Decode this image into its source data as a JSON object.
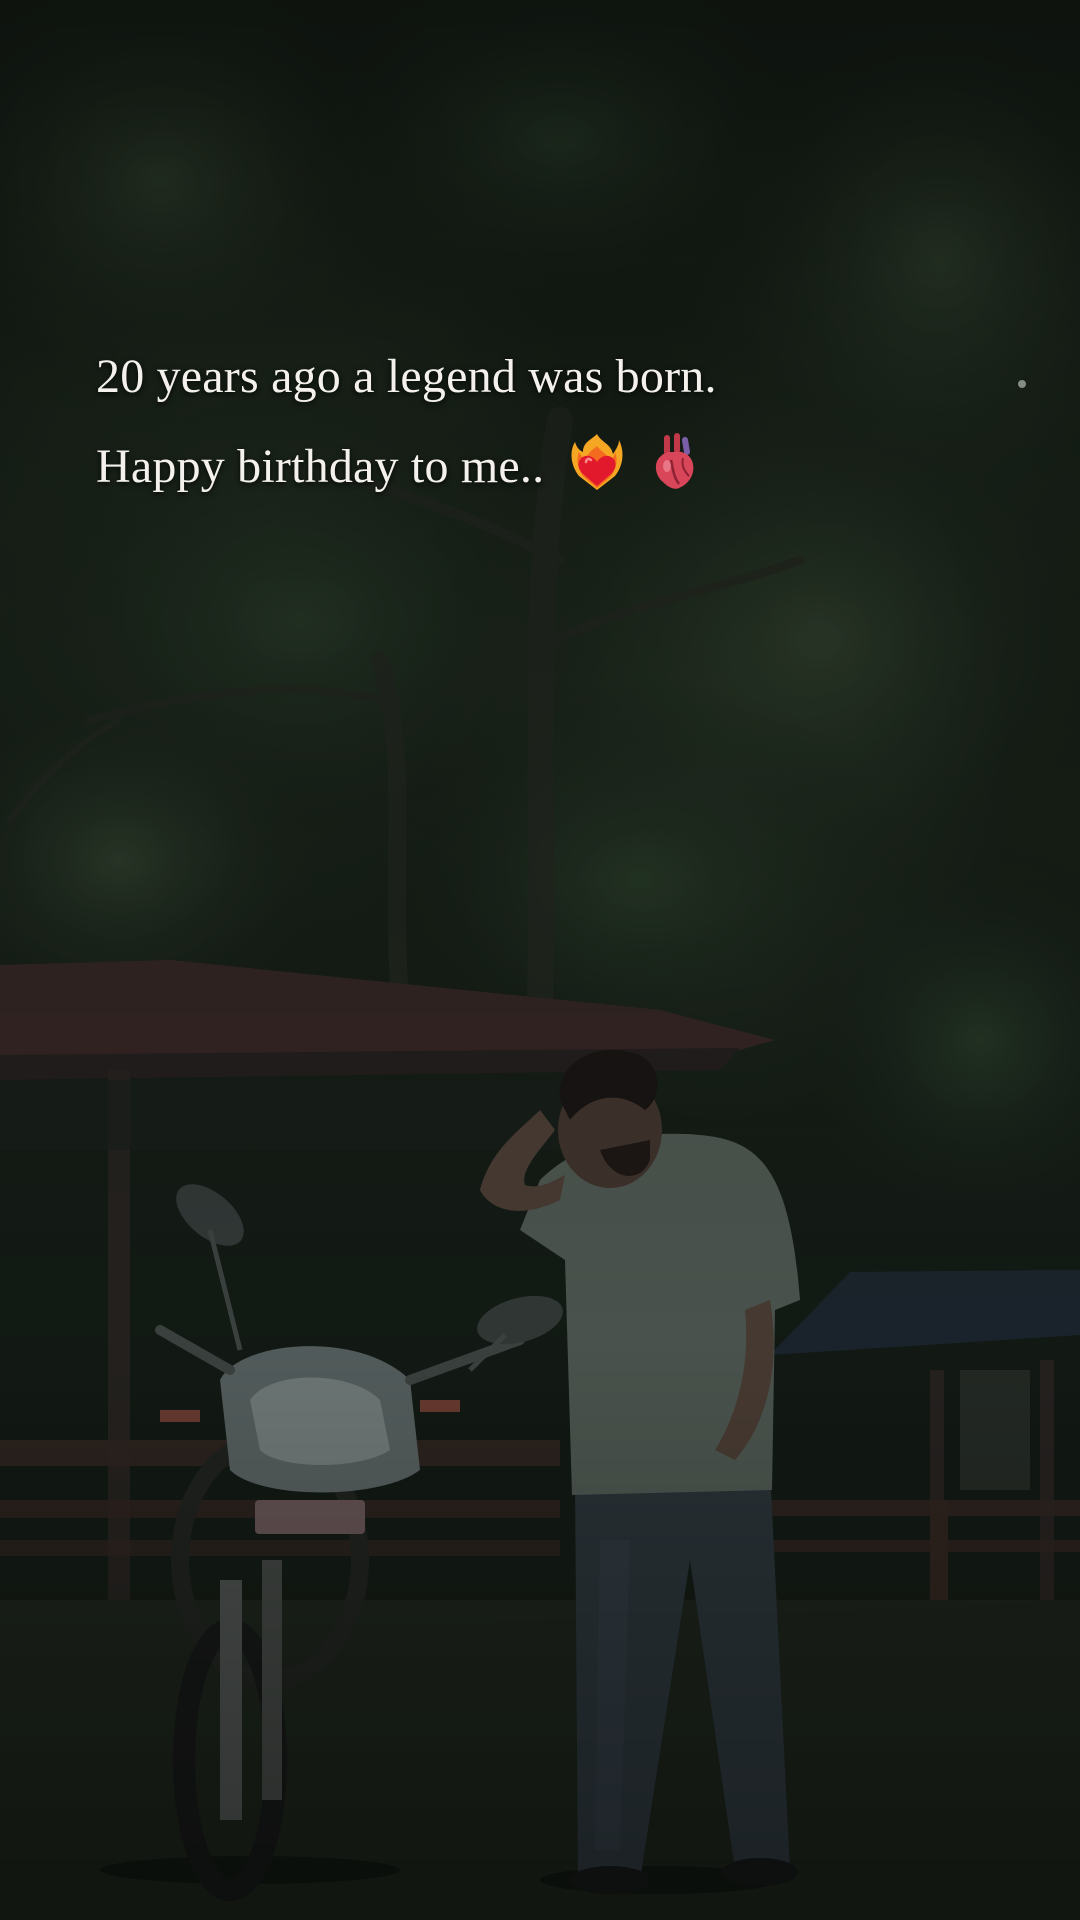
{
  "caption": {
    "line1": "20 years ago a legend was born.",
    "line2": "Happy birthday to me..",
    "emoji1": "heart-on-fire-icon",
    "emoji2": "anatomical-heart-icon"
  },
  "colors": {
    "text": "#f4f1ec",
    "foliage": "#2e3e2c",
    "roof": "#4a3330",
    "shirt": "#5f6a62",
    "jeans": "#2f3a40"
  }
}
